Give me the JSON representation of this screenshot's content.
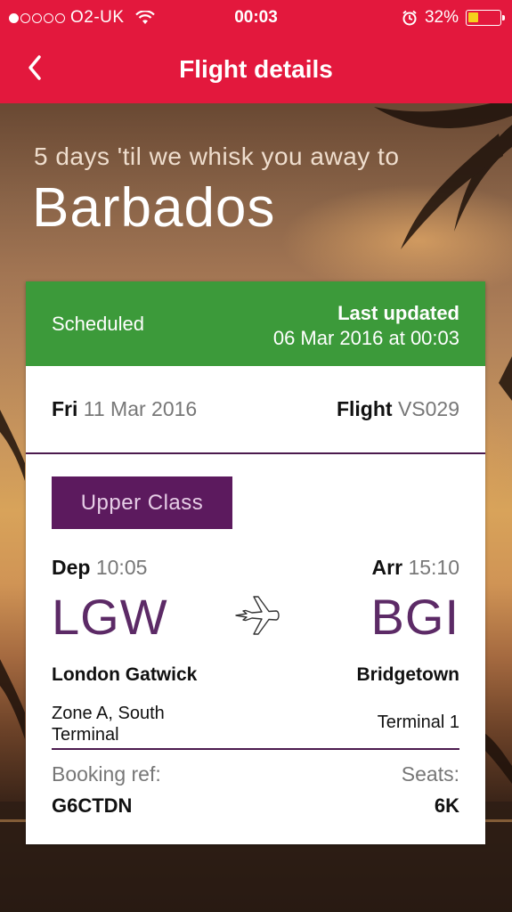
{
  "status_bar": {
    "signal_dots_filled": 1,
    "signal_dots_total": 5,
    "carrier": "O2-UK",
    "time": "00:03",
    "battery_percent": "32%",
    "battery_level": 0.32
  },
  "nav": {
    "title": "Flight details"
  },
  "hero": {
    "countdown": "5 days 'til we whisk you away to",
    "destination": "Barbados"
  },
  "card": {
    "status": "Scheduled",
    "last_updated_label": "Last updated",
    "last_updated_value": "06 Mar 2016 at 00:03",
    "day": "Fri",
    "date": "11 Mar 2016",
    "flight_label": "Flight",
    "flight_number": "VS029",
    "cabin_class": "Upper Class",
    "dep_label": "Dep",
    "dep_time": "10:05",
    "arr_label": "Arr",
    "arr_time": "15:10",
    "dep_code": "LGW",
    "arr_code": "BGI",
    "dep_city": "London Gatwick",
    "arr_city": "Bridgetown",
    "dep_terminal": "Zone A, South Terminal",
    "arr_terminal": "Terminal 1",
    "booking_ref_label": "Booking ref:",
    "booking_ref": "G6CTDN",
    "seats_label": "Seats:",
    "seats": "6K"
  },
  "colors": {
    "brand_red": "#e3183d",
    "status_green": "#3c9a3a",
    "purple": "#5c1a5e"
  }
}
